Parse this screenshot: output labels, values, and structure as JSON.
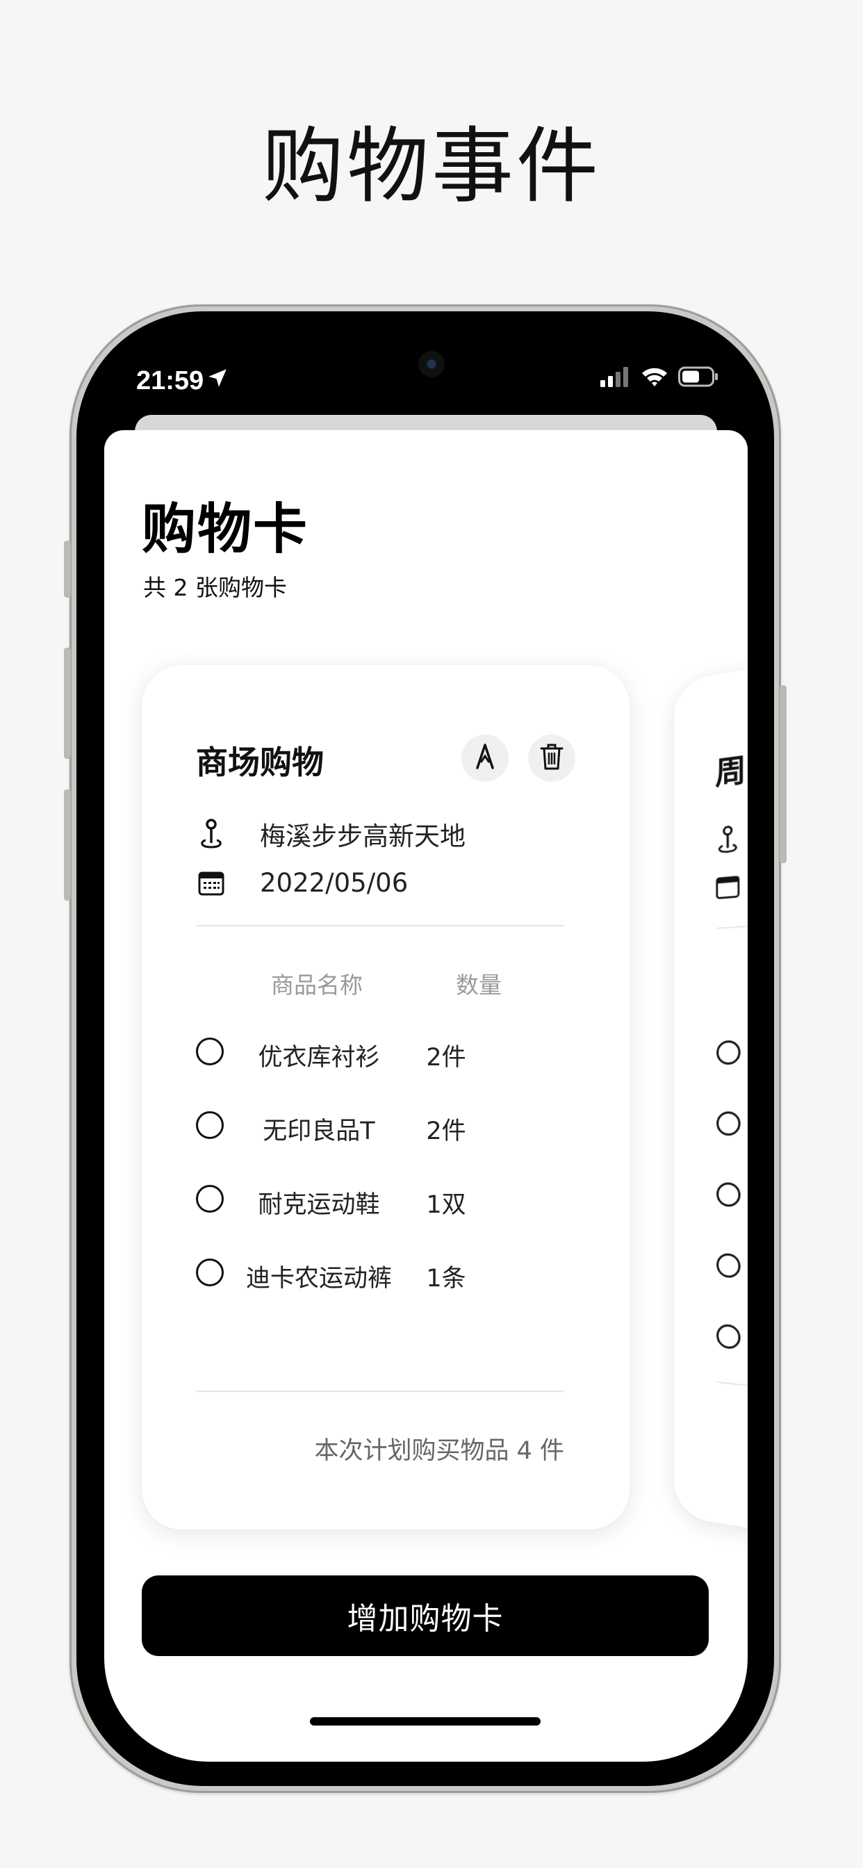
{
  "promo": {
    "title": "购物事件"
  },
  "status_bar": {
    "time": "21:59"
  },
  "header": {
    "title": "购物卡",
    "subtitle": "共 2 张购物卡"
  },
  "cards": [
    {
      "title": "商场购物",
      "location": "梅溪步步高新天地",
      "date": "2022/05/06",
      "columns": {
        "name": "商品名称",
        "qty": "数量"
      },
      "items": [
        {
          "name": "优衣库衬衫",
          "qty": "2件"
        },
        {
          "name": "无印良品T",
          "qty": "2件"
        },
        {
          "name": "耐克运动鞋",
          "qty": "1双"
        },
        {
          "name": "迪卡农运动裤",
          "qty": "1条"
        }
      ],
      "footer": "本次计划购买物品 4 件"
    },
    {
      "title": "周"
    }
  ],
  "actions": {
    "add_card_label": "增加购物卡"
  },
  "icons": {
    "edit": "pen-nib-icon",
    "delete": "trash-icon",
    "location": "map-pin-icon",
    "date": "calendar-icon",
    "location_arrow": "location-arrow-icon",
    "signal": "cellular-signal-icon",
    "wifi": "wifi-icon",
    "battery": "battery-icon"
  },
  "colors": {
    "background": "#f6f6f6",
    "primary": "#000000",
    "muted_text": "#9a9a9a"
  }
}
